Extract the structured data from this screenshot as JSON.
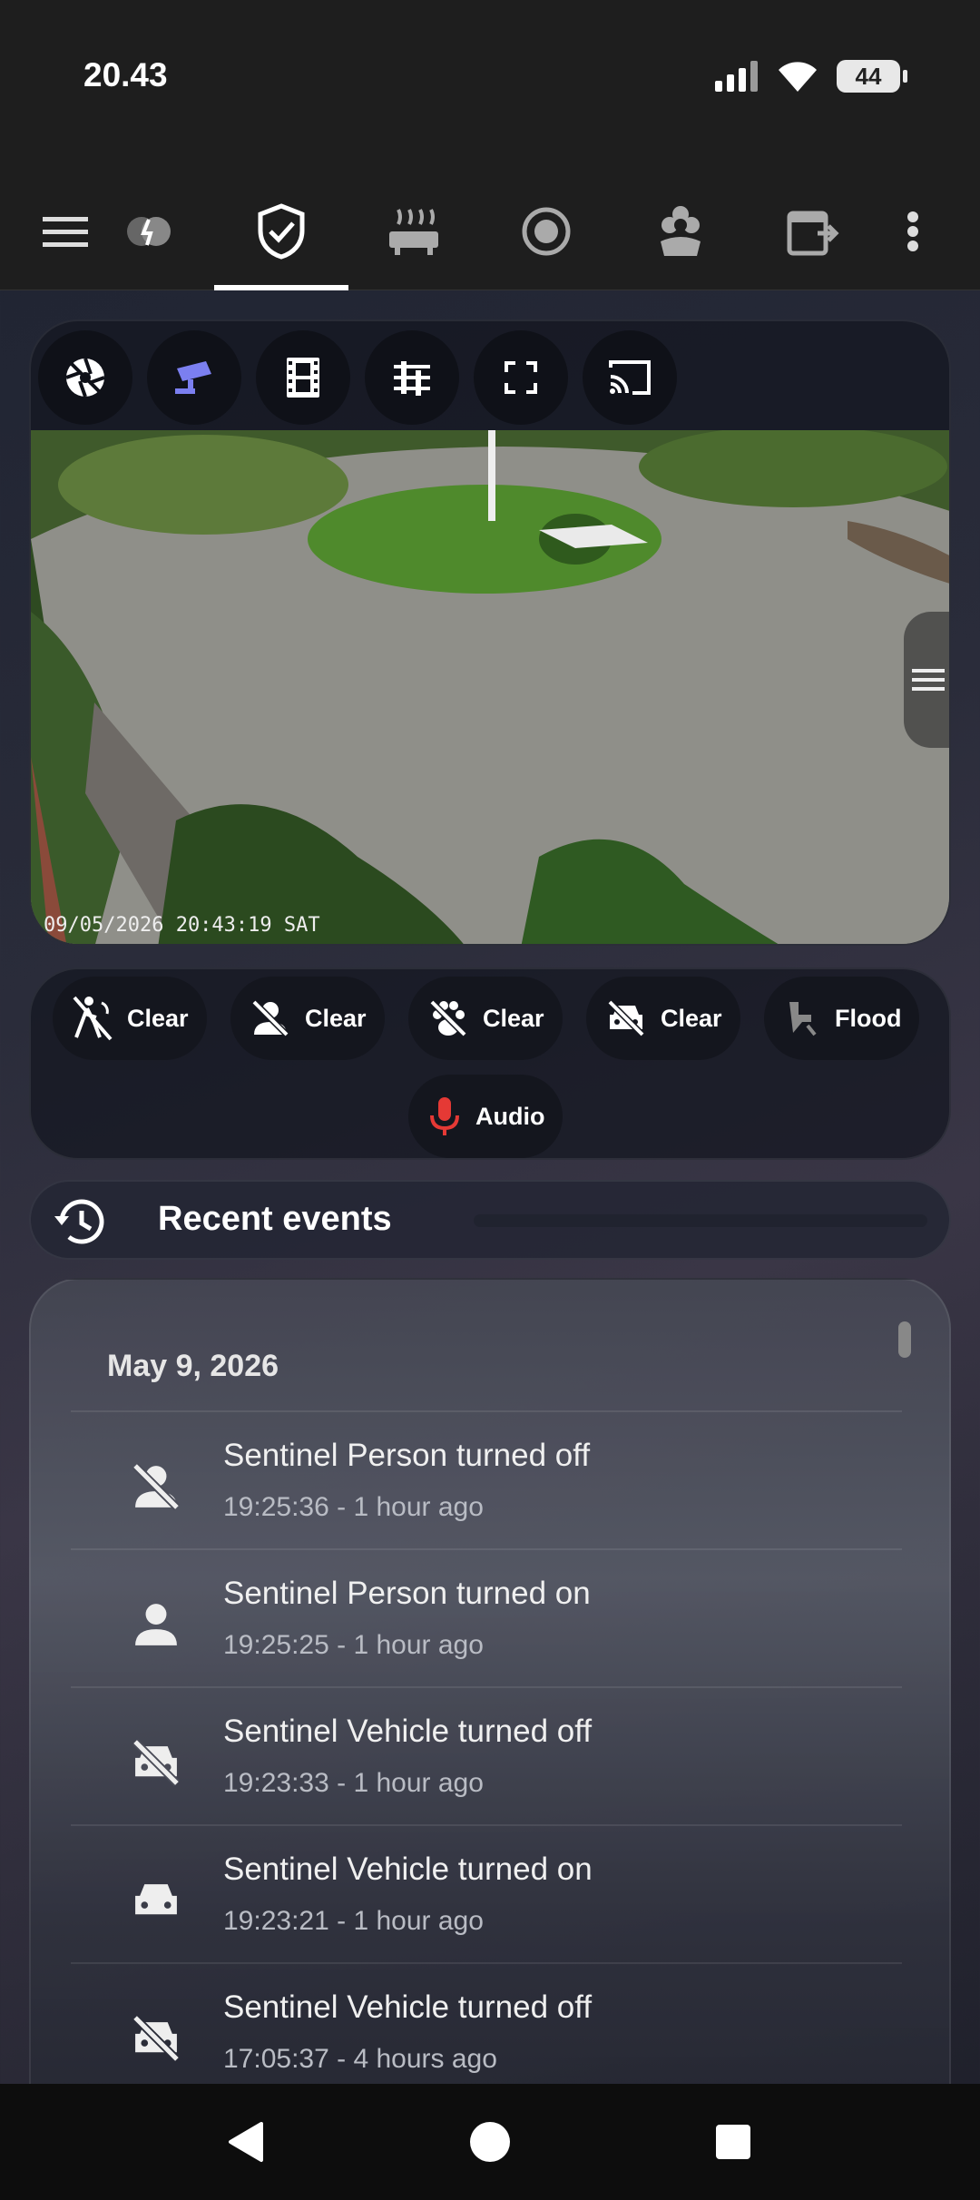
{
  "status_bar": {
    "time": "20.43",
    "battery": "44"
  },
  "tabs": [
    {
      "icon": "energy-icon"
    },
    {
      "icon": "shield-check-icon"
    },
    {
      "icon": "radiator-icon"
    },
    {
      "icon": "robot-vacuum-icon"
    },
    {
      "icon": "flower-icon"
    },
    {
      "icon": "calendar-export-icon"
    }
  ],
  "camera": {
    "timestamp": "09/05/2026 20:43:19 SAT",
    "toolbar": [
      "aperture-icon",
      "cctv-icon",
      "film-icon",
      "tune-icon",
      "fullscreen-icon",
      "cast-icon"
    ]
  },
  "sensors": [
    {
      "label": "Clear",
      "icon": "motion-sensor-off-icon"
    },
    {
      "label": "Clear",
      "icon": "account-off-icon"
    },
    {
      "label": "Clear",
      "icon": "paw-off-icon"
    },
    {
      "label": "Clear",
      "icon": "car-off-icon"
    },
    {
      "label": "Flood",
      "icon": "floodlight-icon"
    },
    {
      "label": "Audio",
      "icon": "microphone-icon",
      "icon_color": "#e53935"
    }
  ],
  "recent": {
    "title": "Recent events"
  },
  "events": {
    "date": "May 9, 2026",
    "items": [
      {
        "title": "Sentinel Person turned off",
        "time": "19:25:36 - 1 hour ago",
        "icon": "account-off-icon"
      },
      {
        "title": "Sentinel Person turned on",
        "time": "19:25:25 - 1 hour ago",
        "icon": "account-icon"
      },
      {
        "title": "Sentinel Vehicle turned off",
        "time": "19:23:33 - 1 hour ago",
        "icon": "car-off-icon"
      },
      {
        "title": "Sentinel Vehicle turned on",
        "time": "19:23:21 - 1 hour ago",
        "icon": "car-icon"
      },
      {
        "title": "Sentinel Vehicle turned off",
        "time": "17:05:37 - 4 hours ago",
        "icon": "car-off-icon"
      }
    ]
  }
}
